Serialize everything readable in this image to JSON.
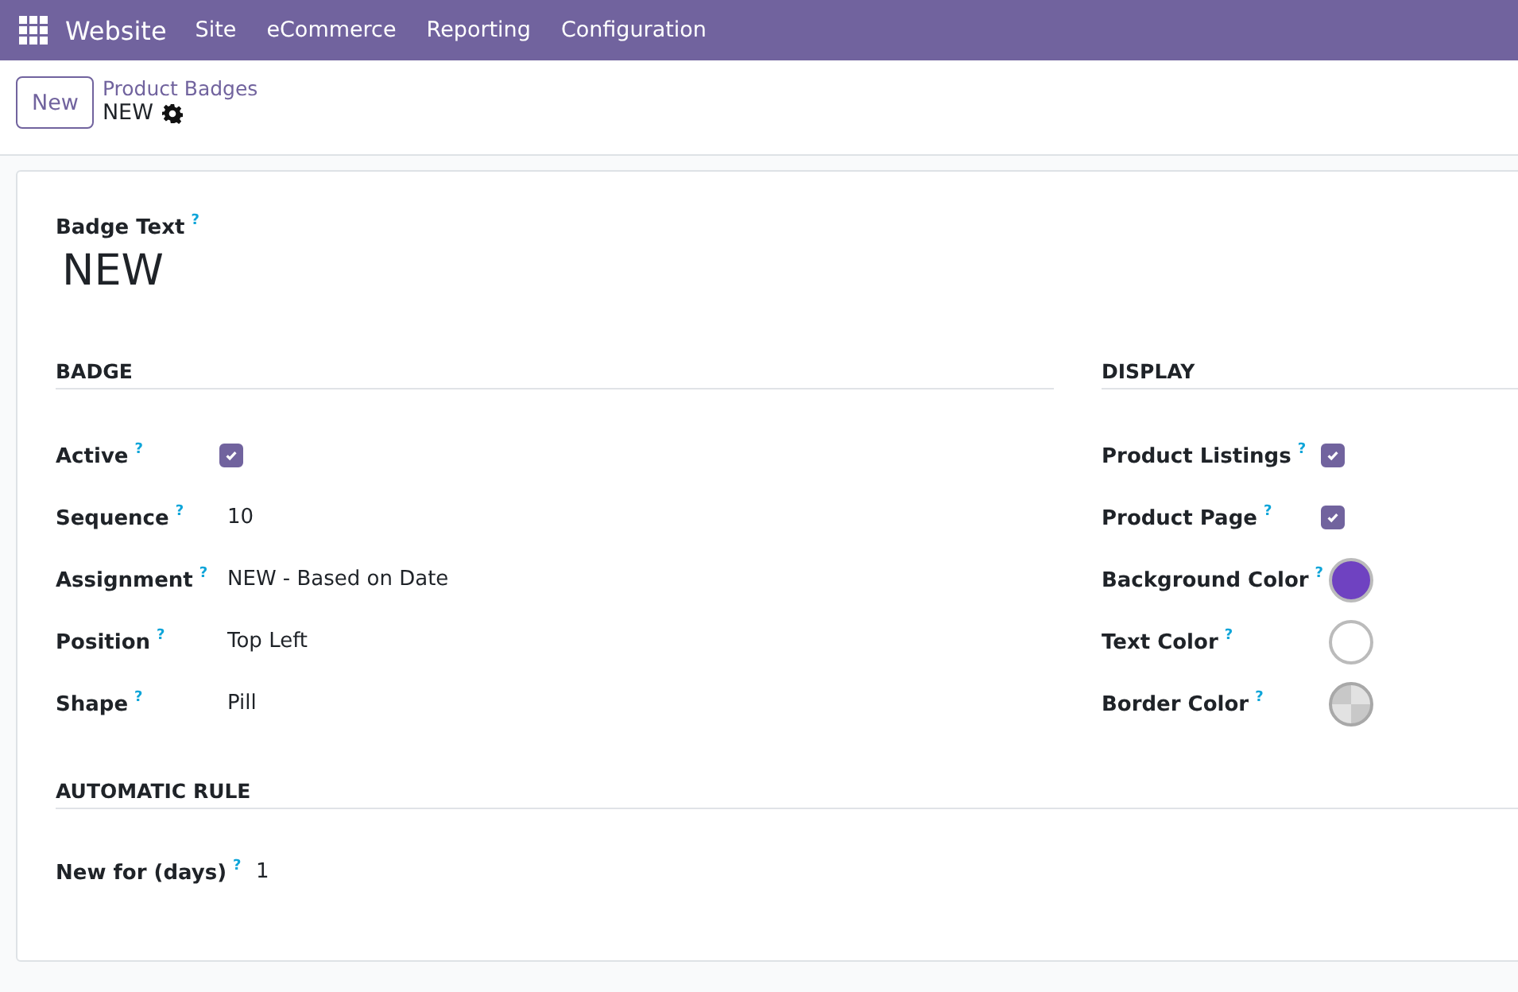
{
  "navbar": {
    "app": "Website",
    "menu": [
      "Site",
      "eCommerce",
      "Reporting",
      "Configuration"
    ]
  },
  "control_panel": {
    "new_button": "New",
    "breadcrumb": "Product Badges",
    "record": "NEW"
  },
  "form": {
    "title_label": "Badge Text",
    "title_help": "?",
    "title_value": "NEW",
    "sections": [
      {
        "title": "BADGE",
        "fields": [
          {
            "label": "Active",
            "help": "?",
            "kind": "checkbox",
            "checked": true
          },
          {
            "label": "Sequence",
            "help": "?",
            "kind": "text",
            "value": "10"
          },
          {
            "label": "Assignment",
            "help": "?",
            "kind": "text",
            "value": "NEW - Based on Date"
          },
          {
            "label": "Position",
            "help": "?",
            "kind": "text",
            "value": "Top Left"
          },
          {
            "label": "Shape",
            "help": "?",
            "kind": "text",
            "value": "Pill"
          }
        ]
      },
      {
        "title": "DISPLAY",
        "fields": [
          {
            "label": "Product Listings",
            "help": "?",
            "kind": "checkbox",
            "checked": true
          },
          {
            "label": "Product Page",
            "help": "?",
            "kind": "checkbox",
            "checked": true
          },
          {
            "label": "Background Color",
            "help": "?",
            "kind": "color",
            "color": "#6f42c1"
          },
          {
            "label": "Text Color",
            "help": "?",
            "kind": "color",
            "color": "#ffffff"
          },
          {
            "label": "Border Color",
            "help": "?",
            "kind": "transparent_color"
          }
        ]
      },
      {
        "title": "AUTOMATIC RULE",
        "fields": [
          {
            "label": "New for (days)",
            "help": "?",
            "kind": "text",
            "value": "1"
          }
        ]
      }
    ]
  }
}
